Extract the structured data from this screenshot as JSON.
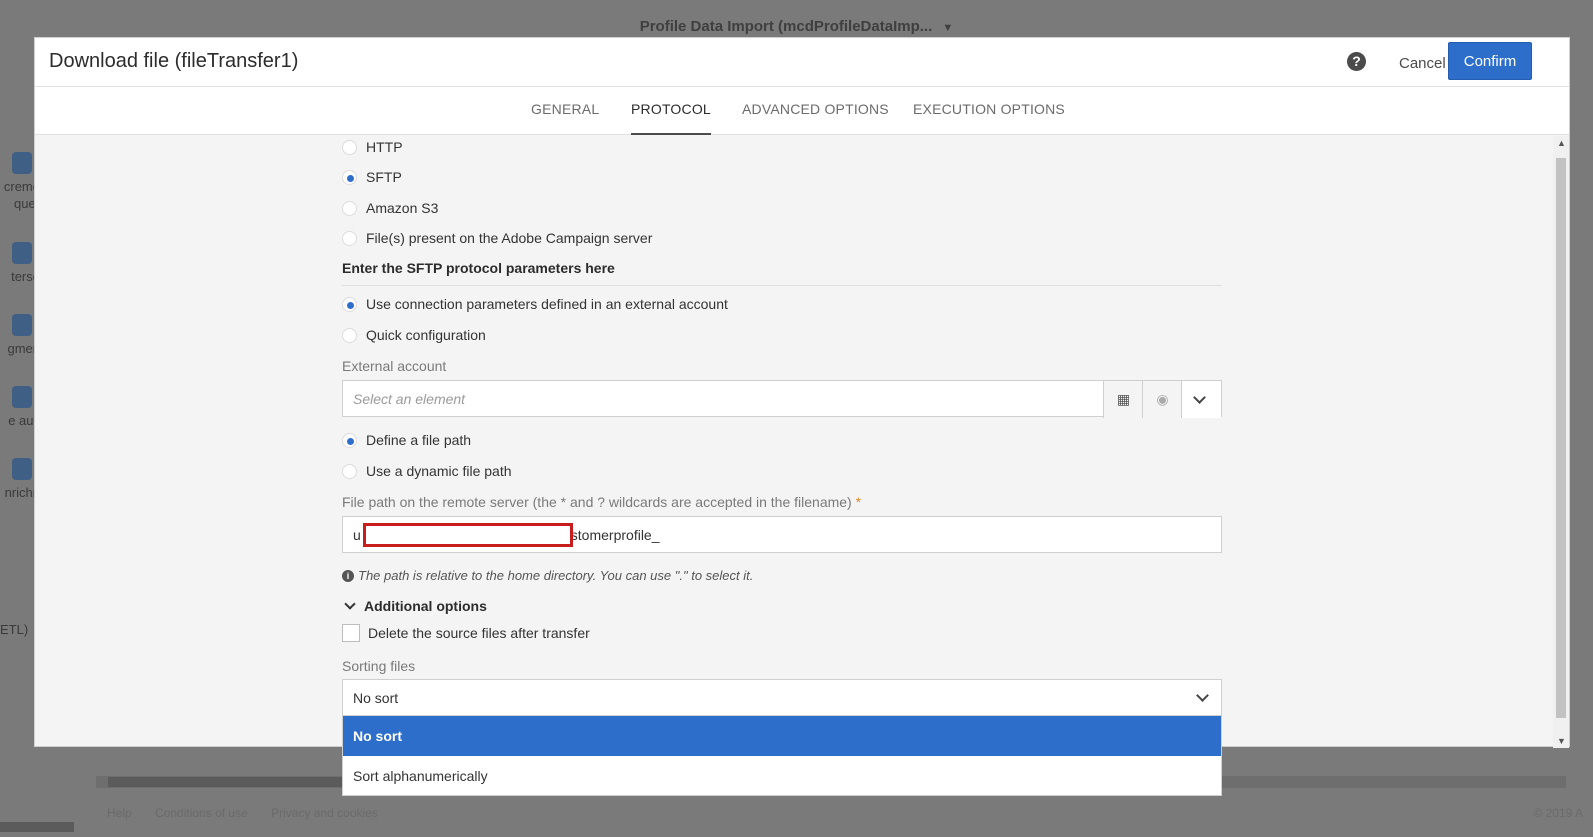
{
  "background": {
    "title": "Profile Data Import (mcdProfileDataImp...",
    "left_labels": [
      "creme\nquer",
      "terse",
      "gmen",
      "e auc",
      "nrichn"
    ],
    "etl_label": "ETL)",
    "footer": [
      "Help",
      "Conditions of use",
      "Privacy and cookies"
    ],
    "copyright": "© 2019 A"
  },
  "dialog": {
    "title": "Download file (fileTransfer1)",
    "help_label": "?",
    "cancel_label": "Cancel",
    "confirm_label": "Confirm"
  },
  "tabs": [
    {
      "label": "GENERAL",
      "active": false
    },
    {
      "label": "PROTOCOL",
      "active": true
    },
    {
      "label": "ADVANCED OPTIONS",
      "active": false
    },
    {
      "label": "EXECUTION OPTIONS",
      "active": false
    }
  ],
  "protocol": {
    "options": [
      {
        "label": "HTTP",
        "selected": false
      },
      {
        "label": "SFTP",
        "selected": true
      },
      {
        "label": "Amazon S3",
        "selected": false
      },
      {
        "label": "File(s) present on the Adobe Campaign server",
        "selected": false
      }
    ],
    "section_title": "Enter the SFTP protocol parameters here",
    "connection_options": [
      {
        "label": "Use connection parameters defined in an external account",
        "selected": true
      },
      {
        "label": "Quick configuration",
        "selected": false
      }
    ],
    "external_account_label": "External account",
    "external_account_placeholder": "Select an element",
    "path_options": [
      {
        "label": "Define a file path",
        "selected": true
      },
      {
        "label": "Use a dynamic file path",
        "selected": false
      }
    ],
    "file_path_label": "File path on the remote server (the * and ? wildcards are accepted in the filename)",
    "required_mark": "*",
    "file_path_prefix": "u",
    "file_path_suffix": "stomerprofile_",
    "path_note": "The path is relative to the home directory. You can use \".\" to select it.",
    "info_glyph": "i",
    "additional_options_label": "Additional options",
    "delete_source_label": "Delete the source files after transfer",
    "sorting_label": "Sorting files",
    "sorting_value": "No sort",
    "sorting_options": [
      {
        "label": "No sort",
        "selected": true
      },
      {
        "label": "Sort alphanumerically",
        "selected": false
      }
    ]
  }
}
